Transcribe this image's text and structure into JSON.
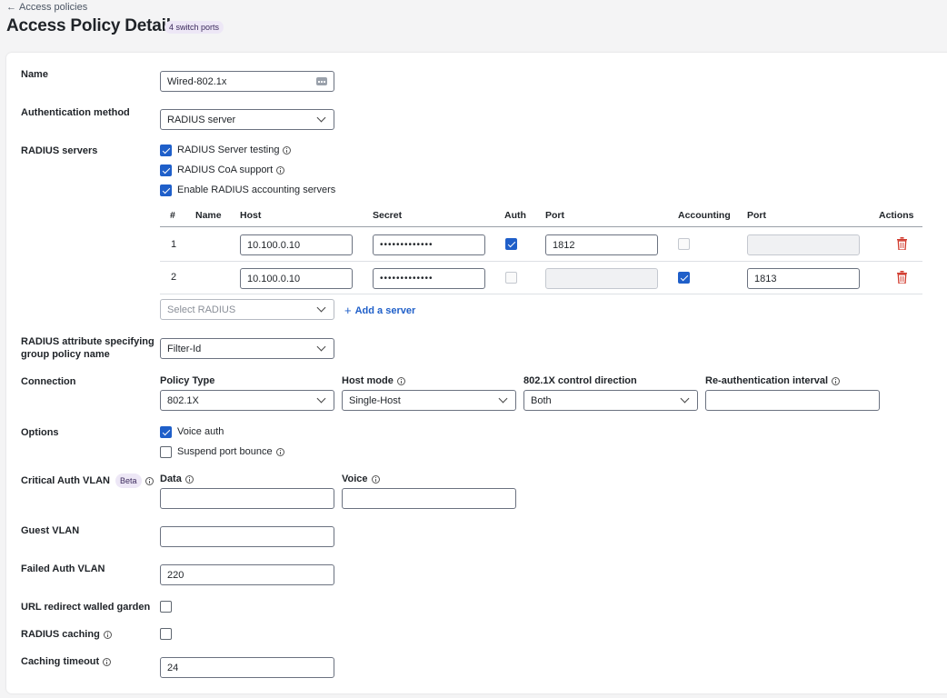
{
  "header": {
    "back_label": "Access policies",
    "title": "Access Policy Detail",
    "badge": "4 switch ports"
  },
  "name": {
    "label": "Name",
    "value": "Wired-802.1x"
  },
  "auth_method": {
    "label": "Authentication method",
    "value": "RADIUS server"
  },
  "radius_servers": {
    "label": "RADIUS servers",
    "options": [
      {
        "label": "RADIUS Server testing",
        "checked": true,
        "info": true
      },
      {
        "label": "RADIUS CoA support",
        "checked": true,
        "info": true
      },
      {
        "label": "Enable RADIUS accounting servers",
        "checked": true,
        "info": false
      }
    ],
    "columns": [
      "#",
      "Name",
      "Host",
      "Secret",
      "Auth",
      "Port",
      "Accounting",
      "Port",
      "Actions"
    ],
    "rows": [
      {
        "index": "1",
        "host": "10.100.0.10",
        "secret": "•••••••••••••",
        "auth": true,
        "auth_port": "1812",
        "accounting": false,
        "acct_port": ""
      },
      {
        "index": "2",
        "host": "10.100.0.10",
        "secret": "•••••••••••••",
        "auth": false,
        "auth_port": "",
        "accounting": true,
        "acct_port": "1813"
      }
    ],
    "select_placeholder": "Select RADIUS",
    "add_label": "Add a server"
  },
  "group_policy_attr": {
    "label_line1": "RADIUS attribute specifying",
    "label_line2": "group policy name",
    "value": "Filter-Id"
  },
  "connection": {
    "label": "Connection",
    "policy_type": {
      "label": "Policy Type",
      "value": "802.1X"
    },
    "host_mode": {
      "label": "Host mode",
      "value": "Single-Host"
    },
    "control_direction": {
      "label": "802.1X control direction",
      "value": "Both"
    },
    "reauth": {
      "label": "Re-authentication interval",
      "value": ""
    }
  },
  "options": {
    "label": "Options",
    "voice_auth": {
      "label": "Voice auth",
      "checked": true
    },
    "suspend_bounce": {
      "label": "Suspend port bounce",
      "checked": false
    }
  },
  "critical_vlan": {
    "label": "Critical Auth VLAN",
    "badge": "Beta",
    "data_label": "Data",
    "voice_label": "Voice",
    "data_value": "",
    "voice_value": ""
  },
  "guest_vlan": {
    "label": "Guest VLAN",
    "value": ""
  },
  "failed_vlan": {
    "label": "Failed Auth VLAN",
    "value": "220"
  },
  "url_redirect": {
    "label": "URL redirect walled garden",
    "checked": false
  },
  "radius_caching": {
    "label": "RADIUS caching",
    "checked": false
  },
  "caching_timeout": {
    "label": "Caching timeout",
    "value": "24"
  },
  "colors": {
    "accent": "#1f5fc9",
    "danger": "#d13b2e",
    "badge_bg": "#ede7f6"
  }
}
